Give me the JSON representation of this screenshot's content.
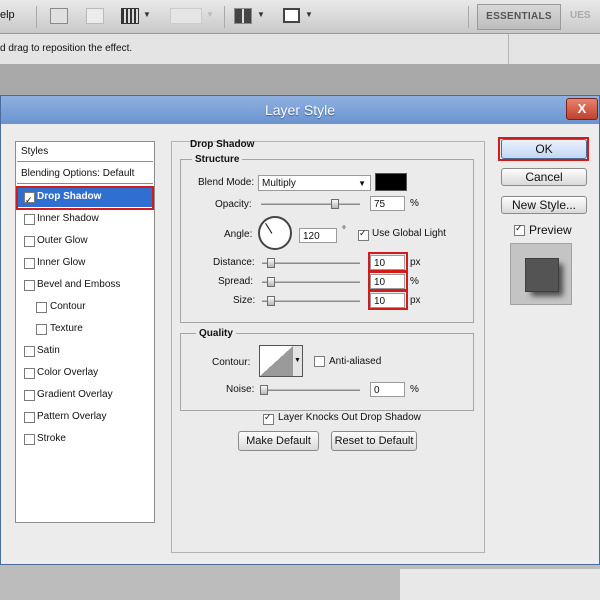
{
  "appbar": {
    "menu_fragment": "elp",
    "essentials_label": "ESSENTIALS",
    "ues_fragment": "UES"
  },
  "optbar": {
    "hint": "d drag to reposition the effect."
  },
  "dialog": {
    "title": "Layer Style",
    "close_label": "X",
    "styles_header": "Styles",
    "styles_items": [
      {
        "label": "Blending Options: Default",
        "checkbox": false,
        "checked": false
      },
      {
        "label": "Drop Shadow",
        "checkbox": true,
        "checked": true,
        "selected": true
      },
      {
        "label": "Inner Shadow",
        "checkbox": true,
        "checked": false
      },
      {
        "label": "Outer Glow",
        "checkbox": true,
        "checked": false
      },
      {
        "label": "Inner Glow",
        "checkbox": true,
        "checked": false
      },
      {
        "label": "Bevel and Emboss",
        "checkbox": true,
        "checked": false
      },
      {
        "label": "Contour",
        "checkbox": true,
        "checked": false,
        "indent": true
      },
      {
        "label": "Texture",
        "checkbox": true,
        "checked": false,
        "indent": true
      },
      {
        "label": "Satin",
        "checkbox": true,
        "checked": false
      },
      {
        "label": "Color Overlay",
        "checkbox": true,
        "checked": false
      },
      {
        "label": "Gradient Overlay",
        "checkbox": true,
        "checked": false
      },
      {
        "label": "Pattern Overlay",
        "checkbox": true,
        "checked": false
      },
      {
        "label": "Stroke",
        "checkbox": true,
        "checked": false
      }
    ],
    "drop_shadow": {
      "section_title": "Drop Shadow",
      "structure_title": "Structure",
      "blend_mode_label": "Blend Mode:",
      "blend_mode_value": "Multiply",
      "shadow_color": "#000000",
      "opacity_label": "Opacity:",
      "opacity_value": "75",
      "opacity_unit": "%",
      "opacity_fraction": 0.75,
      "angle_label": "Angle:",
      "angle_value": "120",
      "angle_unit": "°",
      "use_global_light_label": "Use Global Light",
      "use_global_light_checked": true,
      "distance_label": "Distance:",
      "distance_value": "10",
      "distance_unit": "px",
      "spread_label": "Spread:",
      "spread_value": "10",
      "spread_unit": "%",
      "size_label": "Size:",
      "size_value": "10",
      "size_unit": "px",
      "quality_title": "Quality",
      "contour_label": "Contour:",
      "anti_aliased_label": "Anti-aliased",
      "anti_aliased_checked": false,
      "noise_label": "Noise:",
      "noise_value": "0",
      "noise_unit": "%",
      "knocks_out_label": "Layer Knocks Out Drop Shadow",
      "knocks_out_checked": true,
      "make_default_label": "Make Default",
      "reset_default_label": "Reset to Default"
    },
    "buttons": {
      "ok": "OK",
      "cancel": "Cancel",
      "new_style": "New Style...",
      "preview_label": "Preview",
      "preview_checked": true
    }
  },
  "colors": {
    "selection": "#2f6fd0",
    "highlight_red": "#d21b1b",
    "title_bar": "#6a93cf"
  }
}
